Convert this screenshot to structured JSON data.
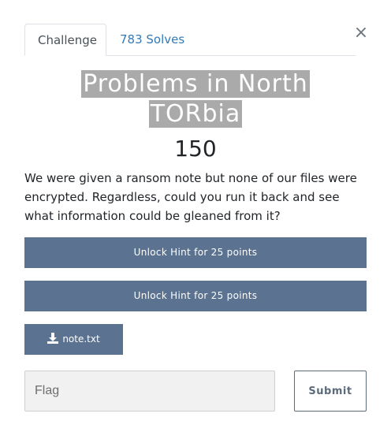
{
  "modal": {
    "close_icon": "×"
  },
  "tabs": [
    {
      "label": "Challenge"
    },
    {
      "label": "783 Solves"
    }
  ],
  "challenge": {
    "title_line1": "Problems in North ",
    "title_line2": "TORbia ",
    "points": "150",
    "description": "We were given a ransom note but none of our files were encrypted. Regardless, could you run it back and see what information could be gleaned from it?"
  },
  "hints": [
    {
      "label": "Unlock Hint for 25 points"
    },
    {
      "label": "Unlock Hint for 25 points"
    }
  ],
  "file": {
    "icon": "download-icon",
    "label": "note.txt"
  },
  "flag_form": {
    "placeholder": "Flag",
    "submit_label": "Submit"
  },
  "colors": {
    "button_bg": "#5b7290",
    "tab_link": "#337ab7",
    "title_highlight": "#aaaaaa"
  }
}
